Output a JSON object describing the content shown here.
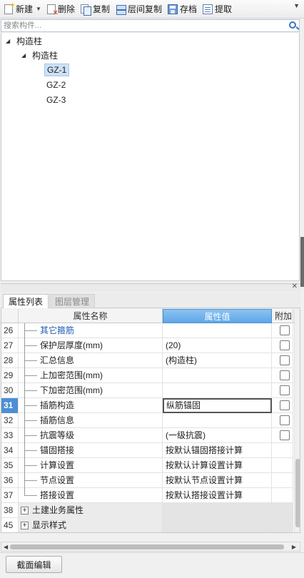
{
  "toolbar": {
    "new_label": "新建",
    "delete_label": "删除",
    "copy_label": "复制",
    "floor_copy_label": "层间复制",
    "save_label": "存档",
    "extract_label": "提取"
  },
  "search": {
    "placeholder": "搜索构件..."
  },
  "tree": {
    "root": "构造柱",
    "child": "构造柱",
    "items": [
      "GZ-1",
      "GZ-2",
      "GZ-3"
    ],
    "selected": "GZ-1"
  },
  "tabs": {
    "properties": "属性列表",
    "floor_manage": "图层管理"
  },
  "grid": {
    "col_name": "属性名称",
    "col_value": "属性值",
    "col_extra": "附加",
    "rows": [
      {
        "num": "26",
        "name": "其它箍筋",
        "value": ""
      },
      {
        "num": "27",
        "name": "保护层厚度(mm)",
        "value": "(20)"
      },
      {
        "num": "28",
        "name": "汇总信息",
        "value": "(构造柱)"
      },
      {
        "num": "29",
        "name": "上加密范围(mm)",
        "value": ""
      },
      {
        "num": "30",
        "name": "下加密范围(mm)",
        "value": ""
      },
      {
        "num": "31",
        "name": "插筋构造",
        "value": "纵筋锚固"
      },
      {
        "num": "32",
        "name": "插筋信息",
        "value": ""
      },
      {
        "num": "33",
        "name": "抗震等级",
        "value": "(一级抗震)"
      },
      {
        "num": "34",
        "name": "锚固搭接",
        "value": "按默认锚固搭接计算"
      },
      {
        "num": "35",
        "name": "计算设置",
        "value": "按默认计算设置计算"
      },
      {
        "num": "36",
        "name": "节点设置",
        "value": "按默认节点设置计算"
      },
      {
        "num": "37",
        "name": "搭接设置",
        "value": "按默认搭接设置计算"
      }
    ],
    "groups": [
      {
        "num": "38",
        "name": "土建业务属性"
      },
      {
        "num": "45",
        "name": "显示样式"
      }
    ]
  },
  "bottom": {
    "section_edit_label": "截面编辑"
  },
  "colors": {
    "header_accent": "#5ea7e8",
    "current_row_number": "#4d8fd4",
    "link_text": "#2360b6",
    "tree_selection": "#cde1f7"
  }
}
